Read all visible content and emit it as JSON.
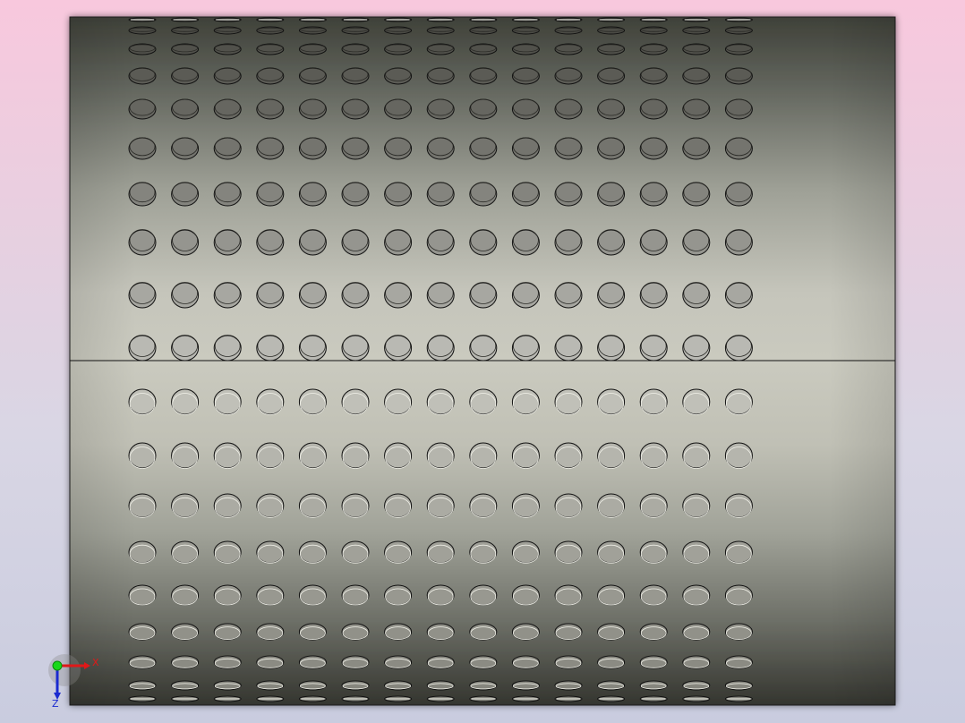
{
  "viewport": {
    "background_top": "#f8c8dd",
    "background_bottom": "#c9ccdf",
    "model_edge_color": "#1a1a1a"
  },
  "model": {
    "type": "perforated-cylinder",
    "hole_rows": 19,
    "hole_columns": 15
  },
  "triad": {
    "x_label": "X",
    "z_label": "Z",
    "x_color": "#e01818",
    "z_color": "#1a2ad0",
    "origin_color": "#18d818"
  }
}
